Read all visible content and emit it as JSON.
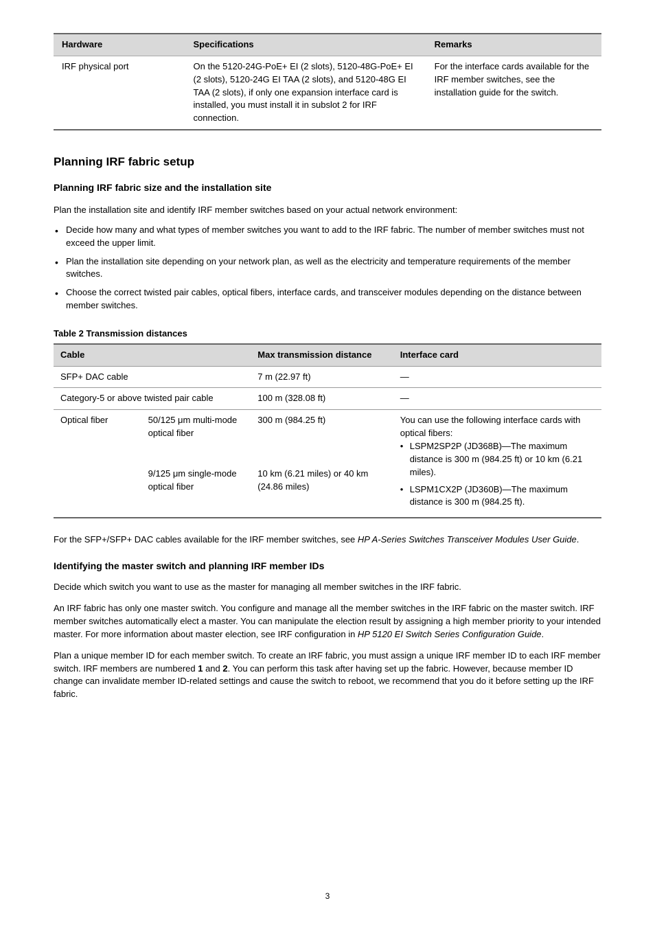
{
  "table1": {
    "headers": [
      "Hardware",
      "Specifications",
      "Remarks"
    ],
    "row": {
      "hardware": "IRF physical port",
      "specs": "On the 5120-24G-PoE+ EI (2 slots), 5120-48G-PoE+ EI (2 slots), 5120-24G EI TAA (2 slots), and 5120-48G EI TAA (2 slots), if only one expansion interface card is installed, you must install it in subslot 2 for IRF connection.",
      "remarks": "For the interface cards available for the IRF member switches, see the installation guide for the switch."
    }
  },
  "heading": "Planning IRF fabric setup",
  "subheading": "Planning IRF fabric size and the installation site",
  "intro": "Plan the installation site and identify IRF member switches based on your actual network environment:",
  "bullets": [
    "Decide how many and what types of member switches you want to add to the IRF fabric. The number of member switches must not exceed the upper limit.",
    "Plan the installation site depending on your network plan, as well as the electricity and temperature requirements of the member switches.",
    "Choose the correct twisted pair cables, optical fibers, interface cards, and transceiver modules depending on the distance between member switches."
  ],
  "t2_caption": "Table 2 Transmission distances",
  "table2": {
    "headers": [
      "Cable",
      "Max transmission distance",
      "Interface card"
    ],
    "rows": [
      {
        "cable_span": "SFP+ DAC cable",
        "sub": "",
        "dist": "7 m (22.97 ft)",
        "card": "—"
      },
      {
        "cable_span": "Category-5 or above twisted pair cable",
        "sub": "",
        "dist": "100 m (328.08 ft)",
        "card": "—"
      }
    ],
    "fiber_label": "Optical fiber",
    "fiber_sub1": {
      "sub": "50/125 μm multi-mode optical fiber",
      "dist": "300 m (984.25 ft)"
    },
    "fiber_sub2": {
      "sub": "9/125 μm single-mode optical fiber",
      "dist": "10 km (6.21 miles) or 40 km (24.86 miles)"
    },
    "fiber_card_intro": "You can use the following interface cards with optical fibers:",
    "fiber_card_items": [
      "LSPM2SP2P (JD368B)—The maximum distance is 300 m (984.25 ft) or 10 km (6.21 miles).",
      "LSPM1CX2P (JD360B)—The maximum distance is 300 m (984.25 ft)."
    ]
  },
  "body": {
    "p1_a": "For the SFP+/SFP+ DAC cables available for the IRF member switches, see ",
    "p1_ital": "HP A-Series Switches Transceiver Modules User Guide",
    "p1_b": ".",
    "p2_head": "Identifying the master switch and planning IRF member IDs",
    "p3": "Decide which switch you want to use as the master for managing all member switches in the IRF fabric.",
    "p4": "An IRF fabric has only one master switch. You configure and manage all the member switches in the IRF fabric on the master switch. IRF member switches automatically elect a master. You can manipulate the election result by assigning a high member priority to your intended master. For more information about master election, see IRF configuration in ",
    "p4_ital": "HP 5120 EI Switch Series Configuration Guide",
    "p4_b": ".",
    "p5_a": "Plan a unique member ID for each member switch. To create an IRF fabric, you must assign a unique IRF member ID to each IRF member switch. IRF members are numbered ",
    "p5_mono": "1",
    "p5_b": " and ",
    "p5_mono2": "2",
    "p5_c": ". You can perform this task after having set up the fabric. However, because member ID change can invalidate member ID-related settings and cause the switch to reboot, we recommend that you do it before setting up the IRF fabric."
  },
  "page": "3"
}
